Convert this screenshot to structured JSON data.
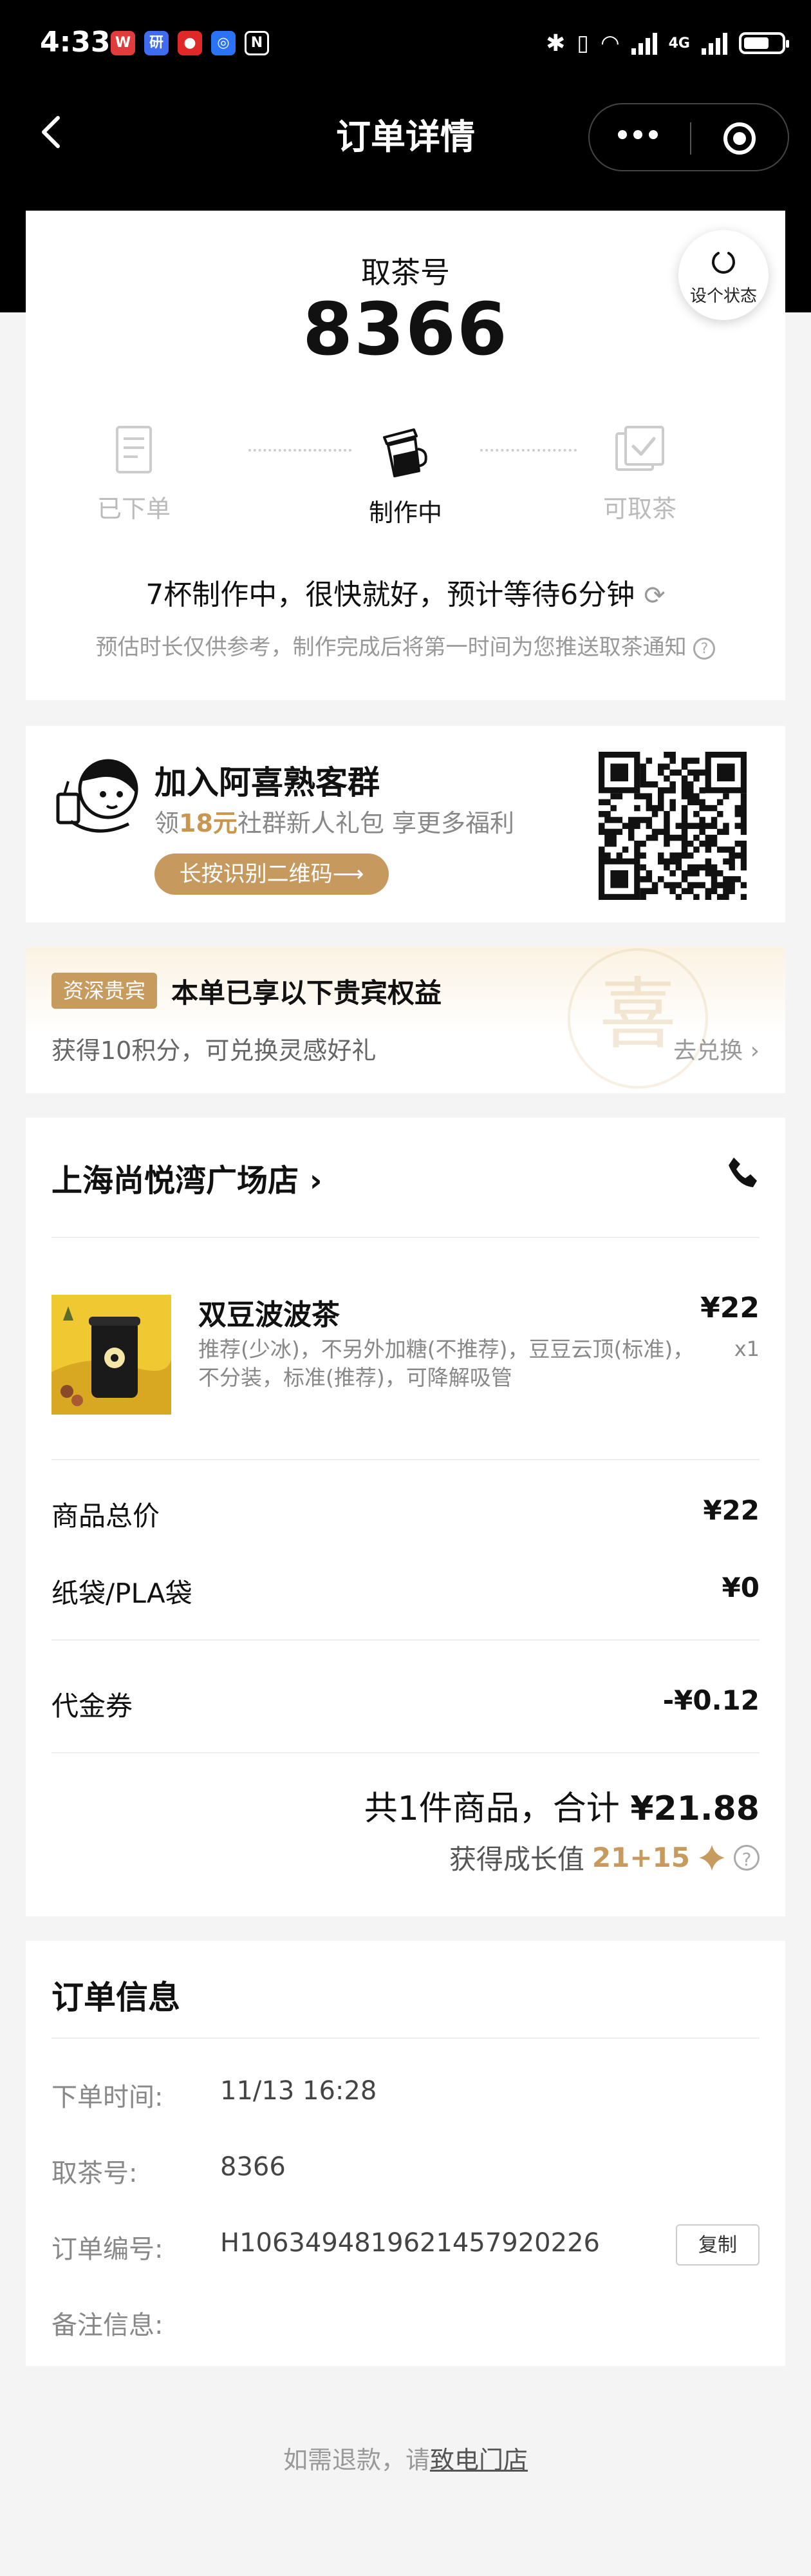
{
  "status_bar": {
    "time": "4:33",
    "apps": [
      {
        "name": "w-app-icon",
        "glyph": "W",
        "color": "#e23b3b"
      },
      {
        "name": "map-app-icon",
        "glyph": "研",
        "color": "#3f6cf0"
      },
      {
        "name": "video-app-icon",
        "glyph": "●",
        "color": "#e02828"
      },
      {
        "name": "link-app-icon",
        "glyph": "◎",
        "color": "#2a72f6"
      },
      {
        "name": "nfc-icon",
        "glyph": "N",
        "color": "#000000"
      }
    ],
    "network": "4G"
  },
  "header": {
    "title": "订单详情"
  },
  "pickup": {
    "label": "取茶号",
    "number": "8366",
    "refresh_label": "设个状态",
    "steps": [
      "已下单",
      "制作中",
      "可取茶"
    ],
    "active_step": 1,
    "progress_text": "7杯制作中，很快就好，预计等待6分钟",
    "note": "预估时长仅供参考，制作完成后将第一时间为您推送取茶通知"
  },
  "group": {
    "title": "加入阿喜熟客群",
    "sub_prefix": "领",
    "sub_highlight": "18元",
    "sub_suffix": "社群新人礼包 享更多福利",
    "button": "长按识别二维码⟶"
  },
  "vip": {
    "tag": "资深贵宾",
    "title": "本单已享以下贵宾权益",
    "desc": "获得10积分，可兑换灵感好礼",
    "exchange": "去兑换 ›",
    "seal_char": "喜"
  },
  "order": {
    "store": "上海尚悦湾广场店 ›",
    "item": {
      "name": "双豆波波茶",
      "desc": "推荐(少冰)，不另外加糖(不推荐)，豆豆云顶(标准)，不分装，标准(推荐)，可降解吸管",
      "price": "¥22",
      "qty": "x1"
    },
    "rows": [
      {
        "label": "商品总价",
        "value": "¥22"
      },
      {
        "label": "纸袋/PLA袋",
        "value": "¥0"
      },
      {
        "label": "代金券",
        "value": "-¥0.12"
      }
    ],
    "total_prefix": "共1件商品，合计",
    "total_value": "¥21.88",
    "growth_label": "获得成长值",
    "growth_value": "21+15"
  },
  "info": {
    "title": "订单信息",
    "rows": [
      {
        "key": "下单时间:",
        "value": "11/13 16:28"
      },
      {
        "key": "取茶号:",
        "value": "8366"
      },
      {
        "key": "订单编号:",
        "value": "H1063494819621457920226"
      },
      {
        "key": "备注信息:",
        "value": ""
      }
    ],
    "copy": "复制"
  },
  "footer": {
    "prefix": "如需退款，请",
    "link": "致电门店"
  }
}
